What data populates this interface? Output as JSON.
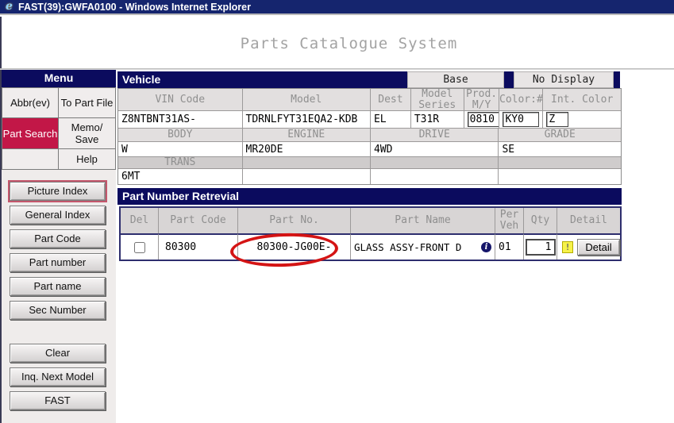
{
  "window": {
    "title": "FAST(39):GWFA0100 - Windows Internet Explorer",
    "icon_glyph": "e"
  },
  "page": {
    "title": "Parts Catalogue System"
  },
  "menu": {
    "title": "Menu",
    "abbrev": "Abbr(ev)",
    "to_part_file": "To Part File",
    "part_search": "Part Search",
    "memo_save": "Memo/ Save",
    "help": "Help",
    "index_buttons": [
      "Picture Index",
      "General Index",
      "Part Code",
      "Part number",
      "Part name",
      "Sec Number"
    ],
    "action_buttons": [
      "Clear",
      "Inq. Next Model",
      "FAST"
    ]
  },
  "vehicle": {
    "title": "Vehicle",
    "tabs": {
      "base": "Base",
      "no_display": "No Display"
    },
    "columns": [
      "VIN Code",
      "Model",
      "Dest",
      "Model Series",
      "Prod. M/Y",
      "Color:#",
      "Int. Color"
    ],
    "values": {
      "vin_code": "Z8NTBNT31AS-",
      "model": "TDRNLFYT31EQA2-KDB",
      "dest": "EL",
      "model_series": "T31R",
      "prod_my": "0810",
      "color_no": "KY0",
      "int_color": "Z"
    },
    "columns2": [
      "BODY",
      "ENGINE",
      "DRIVE",
      "GRADE"
    ],
    "values2": {
      "body": "W",
      "engine": "MR20DE",
      "drive": "4WD",
      "grade": "SE"
    },
    "columns3": [
      "TRANS"
    ],
    "values3": {
      "trans": "6MT"
    }
  },
  "parts": {
    "title": "Part Number Retrevial",
    "columns": [
      "Del",
      "Part Code",
      "Part No.",
      "Part Name",
      "Per Veh",
      "Qty",
      "Detail"
    ],
    "row": {
      "part_code": "80300",
      "part_no": "80300-JG00E-",
      "part_name": "GLASS ASSY-FRONT D",
      "info_glyph": "i",
      "per_veh": "01",
      "qty": "1",
      "warning_glyph": "!",
      "detail_label": "Detail"
    }
  },
  "colors": {
    "titlebar_navy": "#15256e",
    "band_navy": "#0b0b5e",
    "active_red": "#c21747",
    "annotation_red": "#d41414",
    "warning_yellow": "#f6f24a",
    "panel_gray": "#efeceb"
  }
}
